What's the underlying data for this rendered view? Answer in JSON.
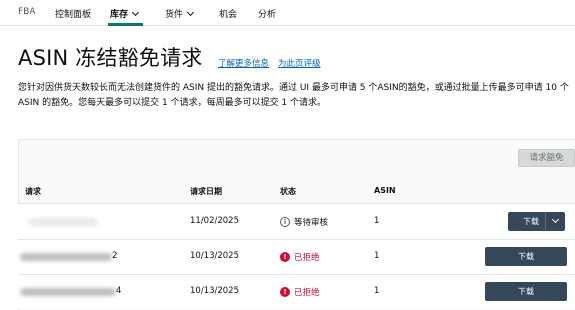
{
  "nav": {
    "items": [
      {
        "label": "FBA"
      },
      {
        "label": "控制面板"
      },
      {
        "label": "库存"
      },
      {
        "label": "货件"
      },
      {
        "label": "机会"
      },
      {
        "label": "分析"
      }
    ]
  },
  "header": {
    "title": "ASIN 冻结豁免请求",
    "learn_more": "了解更多信息",
    "rate_page": "为此页评级"
  },
  "description": "您针对因供货天数较长而无法创建货件的 ASIN 提出的豁免请求。通过 UI 最多可申请 5 个ASIN的豁免，或通过批量上传最多可申请 10 个 ASIN 的豁免。您每天最多可以提交 1 个请求，每周最多可以提交 1 个请求。",
  "toolbar": {
    "request_button": "请求豁免"
  },
  "table": {
    "columns": [
      "请求",
      "请求日期",
      "状态",
      "ASIN"
    ],
    "rows": [
      {
        "request": "",
        "date": "11/02/2025",
        "status": "等待审核",
        "status_type": "pending",
        "asin": "1",
        "action": "下载"
      },
      {
        "request": "2",
        "date": "10/13/2025",
        "status": "已拒绝",
        "status_type": "rejected",
        "asin": "1",
        "action": "下载"
      },
      {
        "request": "4",
        "date": "10/13/2025",
        "status": "已拒绝",
        "status_type": "rejected",
        "asin": "1",
        "action": "下载"
      }
    ]
  },
  "colors": {
    "accent": "#067d62",
    "link": "#0066c0",
    "error": "#cc0c39",
    "button_dark": "#37475a"
  },
  "icons": {
    "pending": "info-circle-icon",
    "rejected": "error-circle-icon",
    "dropdown": "chevron-down-icon"
  }
}
